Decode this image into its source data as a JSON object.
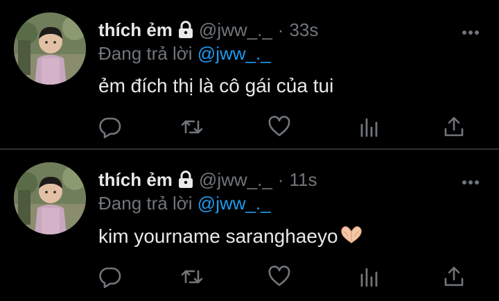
{
  "tweets": [
    {
      "display_name": "thích ẻm",
      "handle": "@jww_._",
      "dot": "·",
      "time": "33s",
      "replying_prefix": "Đang trả lời",
      "replying_to": "@jww_._",
      "text": "ẻm đích thị là cô gái của tui",
      "emoji": ""
    },
    {
      "display_name": "thích ẻm",
      "handle": "@jww_._",
      "dot": "·",
      "time": "11s",
      "replying_prefix": "Đang trả lời",
      "replying_to": "@jww_._",
      "text": "kim yourname saranghaeyo",
      "emoji": "heart-hands"
    }
  ],
  "icons": {
    "lock": "lock-icon",
    "more": "more-icon",
    "reply": "reply-icon",
    "retweet": "retweet-icon",
    "like": "heart-icon",
    "views": "views-icon",
    "share": "share-icon"
  },
  "colors": {
    "background": "#000000",
    "text": "#e7e9ea",
    "secondary": "#71767b",
    "accent": "#1d9bf0",
    "divider": "#2f3336"
  }
}
